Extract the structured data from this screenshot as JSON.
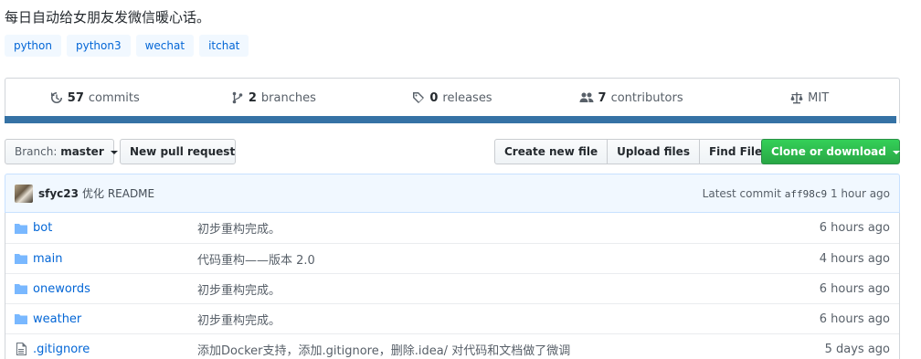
{
  "repo": {
    "description": "每日自动给女朋友发微信暖心话。",
    "topics": [
      "python",
      "python3",
      "wechat",
      "itchat"
    ]
  },
  "summary": {
    "commits": {
      "count": "57",
      "label": "commits"
    },
    "branches": {
      "count": "2",
      "label": "branches"
    },
    "releases": {
      "count": "0",
      "label": "releases"
    },
    "contributors": {
      "count": "7",
      "label": "contributors"
    },
    "license": {
      "label": "MIT"
    },
    "language_color": "#3572a5"
  },
  "toolbar": {
    "branch_label": "Branch:",
    "branch_value": "master",
    "new_pr_label": "New pull request",
    "create_file_label": "Create new file",
    "upload_label": "Upload files",
    "find_label": "Find File",
    "clone_label": "Clone or download"
  },
  "latest_commit": {
    "author": "sfyc23",
    "message": "优化 README",
    "prefix": "Latest commit",
    "sha": "aff98c9",
    "age": "1 hour ago"
  },
  "files": [
    {
      "icon": "folder-icon",
      "name": "bot",
      "message": "初步重构完成。",
      "age": "6 hours ago"
    },
    {
      "icon": "folder-icon",
      "name": "main",
      "message": "代码重构——版本 2.0",
      "age": "4 hours ago"
    },
    {
      "icon": "folder-icon",
      "name": "onewords",
      "message": "初步重构完成。",
      "age": "6 hours ago"
    },
    {
      "icon": "folder-icon",
      "name": "weather",
      "message": "初步重构完成。",
      "age": "6 hours ago"
    },
    {
      "icon": "file-icon",
      "name": ".gitignore",
      "message": "添加Docker支持，添加.gitignore，删除.idea/ 对代码和文档做了微调",
      "age": "5 days ago"
    }
  ]
}
